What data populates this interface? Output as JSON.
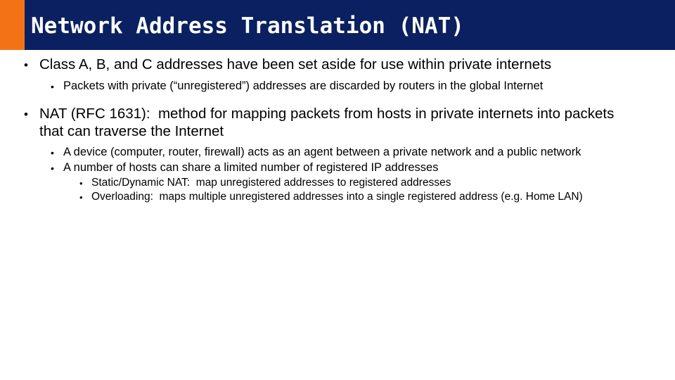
{
  "slide": {
    "title": "Network Address Translation (NAT)",
    "title_bar_color": "#0a2060",
    "title_accent_color": "#f47216",
    "title_text_color": "#ffffff",
    "background_color": "#ffffff",
    "body_text_color": "#000000",
    "bullet_glyph": "•",
    "bullets": [
      {
        "level": 1,
        "text": "Class A, B, and C addresses have been set aside for use within private internets"
      },
      {
        "level": 2,
        "text": "Packets with private (“unregistered”) addresses are discarded by routers in the global Internet"
      },
      {
        "level": 1,
        "text": "NAT (RFC 1631):  method for mapping packets from hosts in private internets into packets that can traverse the Internet"
      },
      {
        "level": 2,
        "text": "A device (computer, router, firewall) acts as an agent between a private network and a public network"
      },
      {
        "level": 2,
        "text": "A number of hosts can share a limited number of registered IP addresses"
      },
      {
        "level": 3,
        "text": "Static/Dynamic NAT:  map unregistered addresses to registered addresses"
      },
      {
        "level": 3,
        "text": "Overloading:  maps multiple unregistered addresses into a single registered address (e.g. Home LAN)"
      }
    ]
  }
}
